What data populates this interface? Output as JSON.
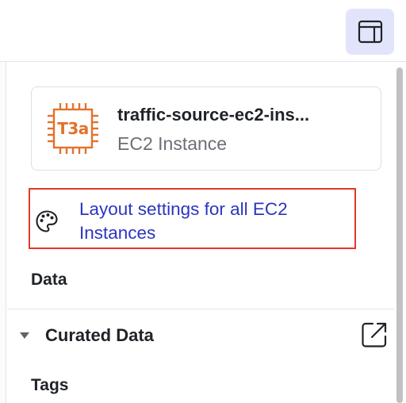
{
  "header": {
    "panel_toggle_icon": "sidebar-panel-icon",
    "accent_color": "#e2e4fb"
  },
  "node_card": {
    "icon": "ec2-instance-chip-icon",
    "icon_label": "T3a",
    "icon_color": "#e2722c",
    "name": "traffic-source-ec2-ins...",
    "type": "EC2 Instance"
  },
  "layout_link": {
    "icon": "palette-icon",
    "label": "Layout settings for all EC2 Instances",
    "highlight_color": "#e03a29"
  },
  "data_section": {
    "title": "Data",
    "curated": {
      "label": "Curated Data",
      "expanded": true,
      "caret_icon": "caret-down-icon",
      "action_icon": "external-link-icon"
    },
    "tags_label": "Tags"
  }
}
